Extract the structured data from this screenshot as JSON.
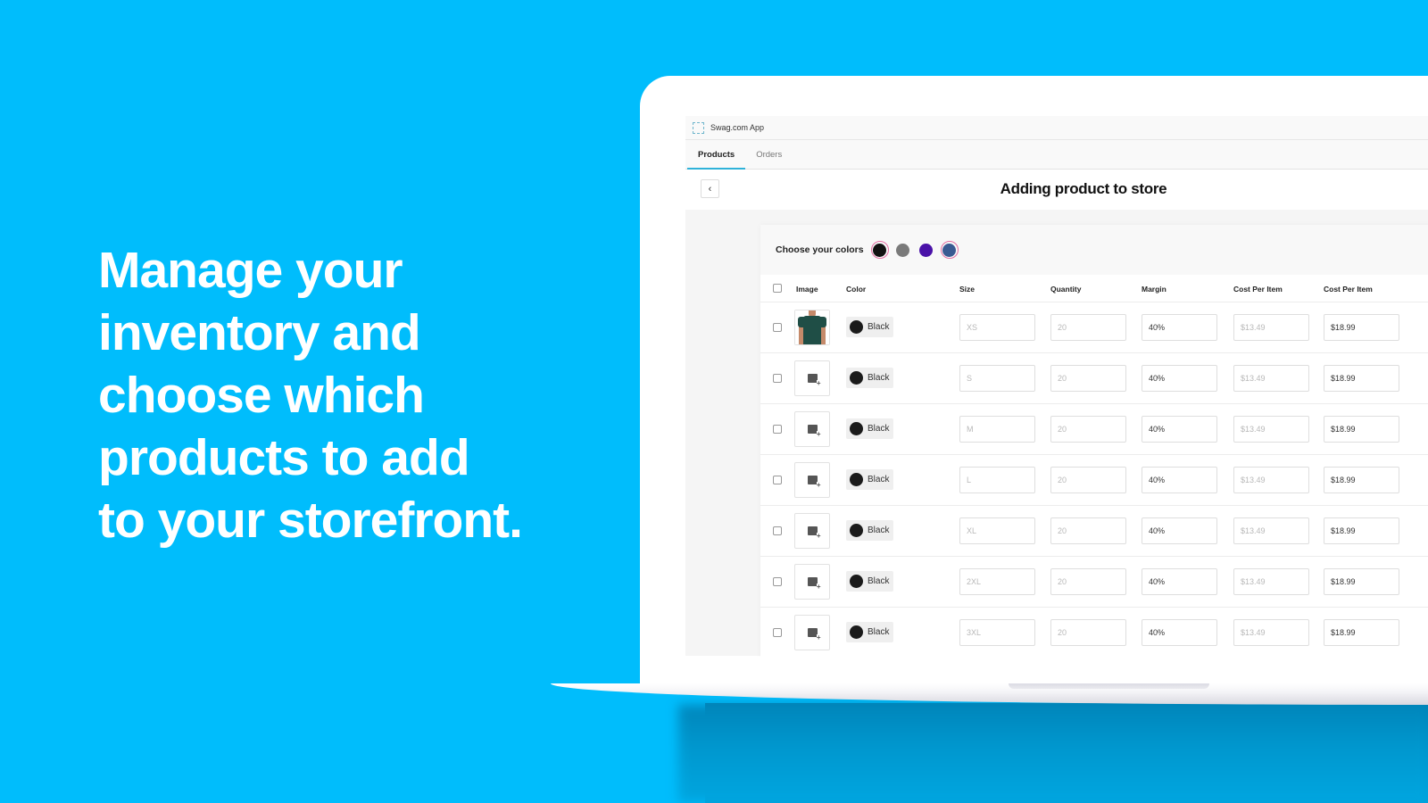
{
  "headline": [
    "Manage your",
    "inventory and",
    "choose which",
    "products to add",
    "to your storefront."
  ],
  "app": {
    "name": "Swag.com App",
    "tabs": [
      {
        "label": "Products",
        "active": true
      },
      {
        "label": "Orders",
        "active": false
      }
    ],
    "back_label": "‹",
    "page_title": "Adding product to store"
  },
  "colors": {
    "label": "Choose your colors",
    "swatches": [
      {
        "hex": "#111111",
        "selected": true
      },
      {
        "hex": "#7a7a7a",
        "selected": false
      },
      {
        "hex": "#4a12a8",
        "selected": false
      },
      {
        "hex": "#3a5a92",
        "selected": true
      }
    ]
  },
  "table": {
    "headers": [
      "Image",
      "Color",
      "Size",
      "Quantity",
      "Margin",
      "Cost Per Item",
      "Cost Per Item"
    ],
    "rows": [
      {
        "image": "product-photo",
        "color": "Black",
        "size": "XS",
        "quantity": "20",
        "margin": "40%",
        "cost": "$13.49",
        "price": "$18.99"
      },
      {
        "image": "add-image",
        "color": "Black",
        "size": "S",
        "quantity": "20",
        "margin": "40%",
        "cost": "$13.49",
        "price": "$18.99"
      },
      {
        "image": "add-image",
        "color": "Black",
        "size": "M",
        "quantity": "20",
        "margin": "40%",
        "cost": "$13.49",
        "price": "$18.99"
      },
      {
        "image": "add-image",
        "color": "Black",
        "size": "L",
        "quantity": "20",
        "margin": "40%",
        "cost": "$13.49",
        "price": "$18.99"
      },
      {
        "image": "add-image",
        "color": "Black",
        "size": "XL",
        "quantity": "20",
        "margin": "40%",
        "cost": "$13.49",
        "price": "$18.99"
      },
      {
        "image": "add-image",
        "color": "Black",
        "size": "2XL",
        "quantity": "20",
        "margin": "40%",
        "cost": "$13.49",
        "price": "$18.99"
      },
      {
        "image": "add-image",
        "color": "Black",
        "size": "3XL",
        "quantity": "20",
        "margin": "40%",
        "cost": "$13.49",
        "price": "$18.99"
      }
    ]
  },
  "theme": {
    "background": "#00bdfc",
    "accent": "#2fb2d9",
    "selected_ring": "#e36da3"
  }
}
